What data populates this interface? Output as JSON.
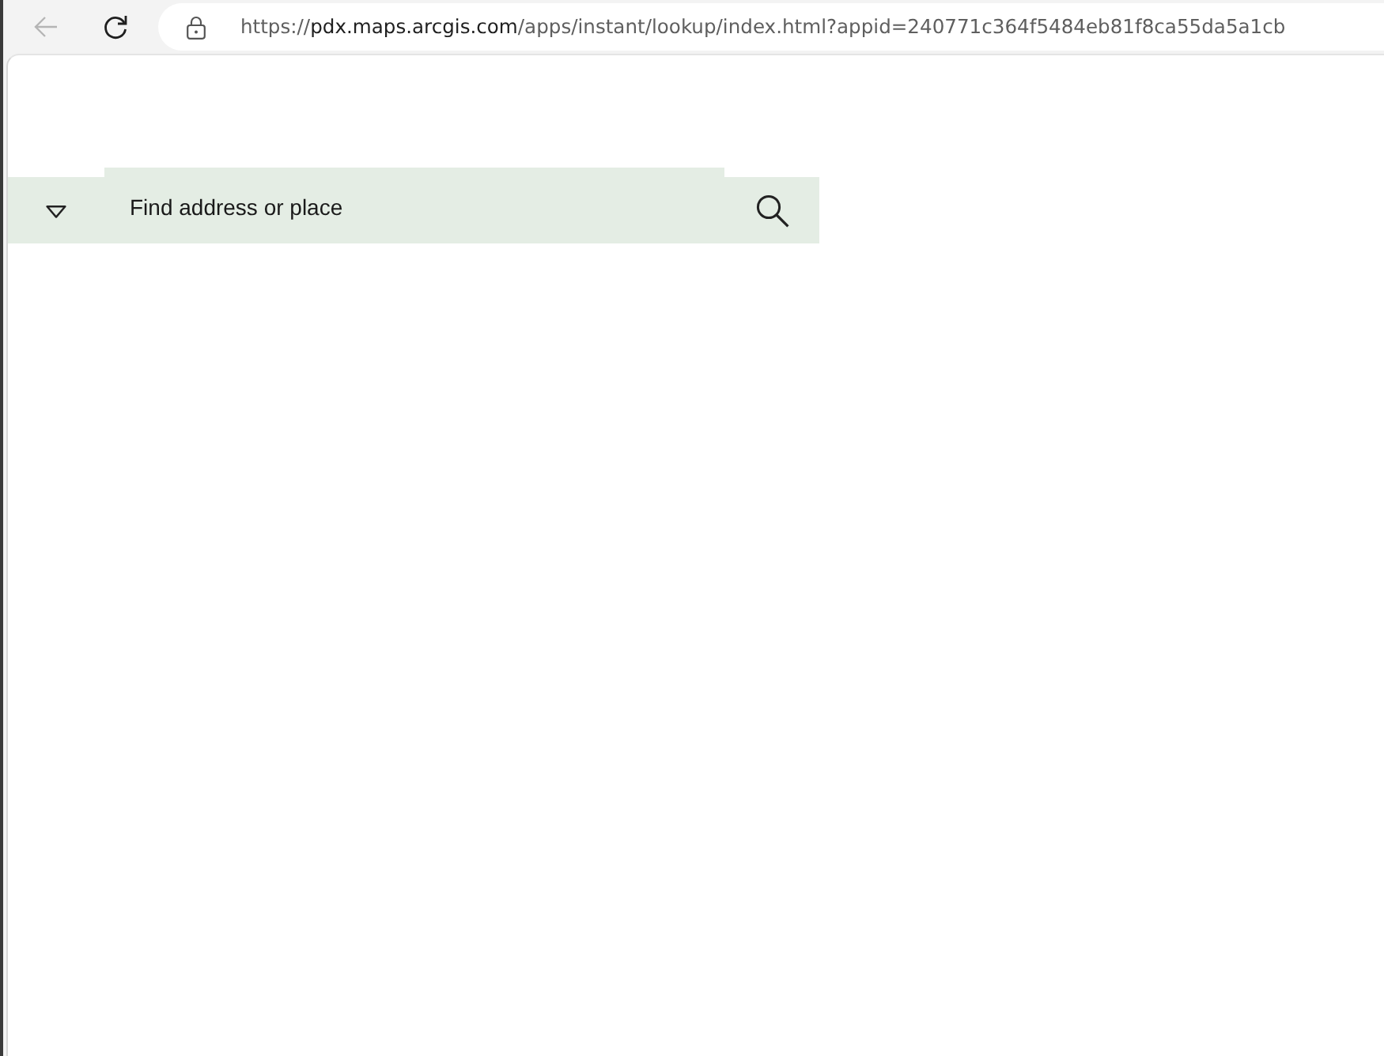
{
  "browser": {
    "back_button": {
      "disabled": true
    },
    "url": {
      "scheme": "https://",
      "host": "pdx.maps.arcgis.com",
      "path": "/apps/instant/lookup/index.html?appid=240771c364f5484eb81f8ca55da5a1cb"
    }
  },
  "search": {
    "placeholder": "Find address or place"
  }
}
